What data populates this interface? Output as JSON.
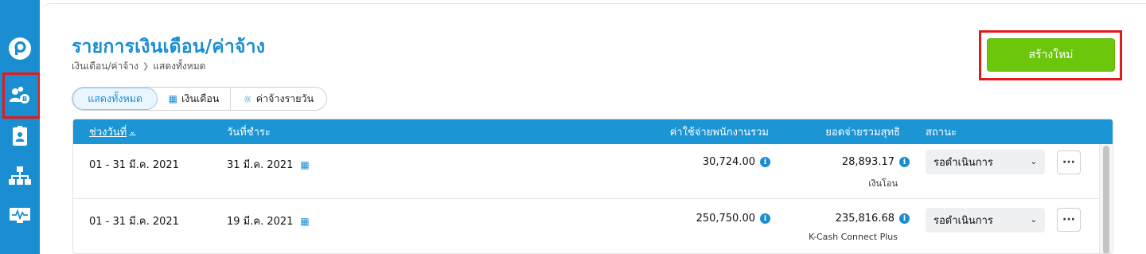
{
  "header": {
    "title": "รายการเงินเดือน/ค่าจ้าง",
    "breadcrumb": [
      "เงินเดือน/ค่าจ้าง",
      "แสดงทั้งหมด"
    ],
    "create_label": "สร้างใหม่"
  },
  "sidebar": {
    "items": [
      "logo-icon",
      "payroll-icon",
      "employee-card-icon",
      "org-chart-icon",
      "monitor-icon"
    ],
    "active": "payroll-icon"
  },
  "tabs": [
    {
      "label": "แสดงทั้งหมด",
      "active": true
    },
    {
      "label": "เงินเดือน",
      "icon": "calendar-icon"
    },
    {
      "label": "ค่าจ้างรายวัน",
      "icon": "sun-icon"
    }
  ],
  "table": {
    "columns": {
      "period": "ช่วงวันที่",
      "pay_date": "วันที่ชำระ",
      "total_cost": "ค่าใช้จ่ายพนักงานรวม",
      "net_total": "ยอดจ่ายรวมสุทธิ",
      "status": "สถานะ"
    },
    "rows": [
      {
        "period": "01 - 31 มี.ค. 2021",
        "pay_date": "31 มี.ค. 2021",
        "total_cost": "30,724.00",
        "net_total": "28,893.17",
        "payment_method": "เงินโอน",
        "status": "รอดำเนินการ"
      },
      {
        "period": "01 - 31 มี.ค. 2021",
        "pay_date": "19 มี.ค. 2021",
        "total_cost": "250,750.00",
        "net_total": "235,816.68",
        "payment_method": "K-Cash Connect Plus",
        "status": "รอดำเนินการ"
      }
    ]
  },
  "colors": {
    "brand_blue": "#1b8ed1",
    "create_green": "#6cc70c",
    "highlight_red": "#e21a1a"
  }
}
